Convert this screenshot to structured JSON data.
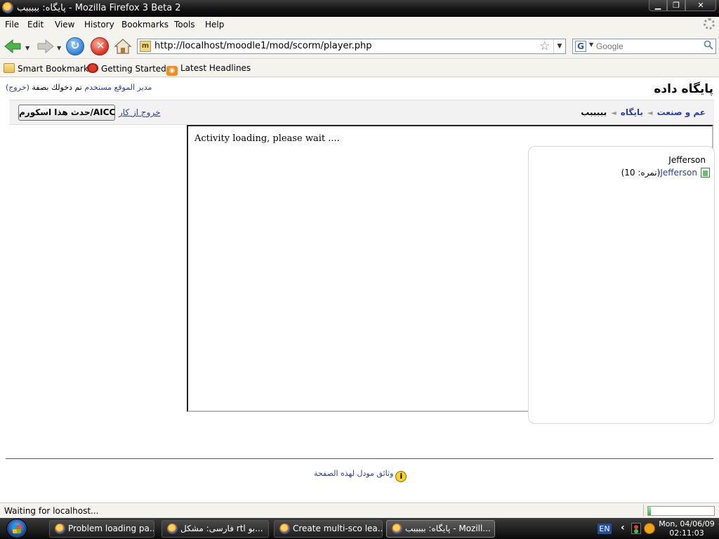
{
  "window": {
    "title": "پایگاه: بببببب - Mozilla Firefox 3 Beta 2",
    "controls": {
      "minimize": "▁",
      "maximize": "❐",
      "close": "✕"
    }
  },
  "menu": [
    "File",
    "Edit",
    "View",
    "History",
    "Bookmarks",
    "Tools",
    "Help"
  ],
  "nav": {
    "url": "http://localhost/moodle1/mod/scorm/player.php",
    "search_placeholder": "Google",
    "search_engine_letter": "G",
    "site_icon_letter": "m"
  },
  "bookmarks": [
    {
      "label": "Smart Bookmarks",
      "icon": "folder-icon"
    },
    {
      "label": "Getting Started",
      "icon": "bug-icon"
    },
    {
      "label": "Latest Headlines",
      "icon": "rss-icon"
    }
  ],
  "page": {
    "login_text": "تم دخولك بصفة",
    "login_user": "مدير الموقع مستخدم",
    "logout": "(خروج)",
    "site_name": "پایگاه داده",
    "update_button": "حدث هذا اسكورم/AICC",
    "exit_link": "خروج از کار",
    "breadcrumb": {
      "item1": "عم و صنعت",
      "item2": "بایگاه",
      "current": "بببببب",
      "separator": "◄"
    },
    "loading_text": "Activity loading, please wait ....",
    "toc": {
      "organization": "Jefferson",
      "item_link": "Jefferson",
      "item_score": "(نمره: 10)"
    },
    "doc_link": "وثائق مودل لهذه الصفحة"
  },
  "status": {
    "text": "Waiting for localhost...",
    "progress": 0.04
  },
  "taskbar": {
    "tasks": [
      "Problem loading pa...",
      "فارسی: مشکل rtl بو...",
      "Create multi-sco lea...",
      "پایگاه: بببببب - Mozill..."
    ],
    "language": "EN",
    "clock_date": "Mon, 04/06/09",
    "clock_time": "02:11:03"
  },
  "colors": {
    "link": "#2a3ea8",
    "chrome_bg": "#f4f3ee",
    "titlebar": "#141414"
  }
}
